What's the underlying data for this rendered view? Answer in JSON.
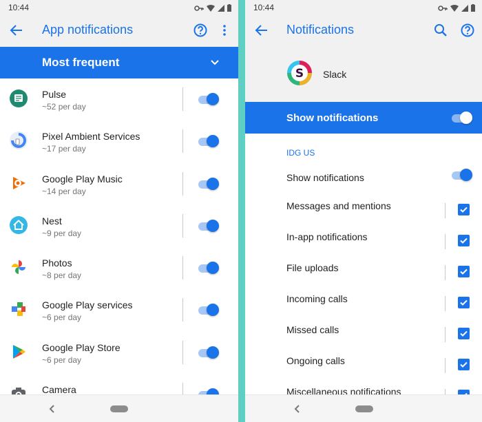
{
  "left": {
    "status": {
      "time": "10:44"
    },
    "appbar": {
      "title": "App notifications"
    },
    "section": {
      "title": "Most frequent"
    },
    "apps": [
      {
        "name": "Pulse",
        "sub": "~52 per day",
        "icon": "pulse-icon",
        "enabled": true
      },
      {
        "name": "Pixel Ambient Services",
        "sub": "~17 per day",
        "icon": "pixel-ambient-icon",
        "enabled": true
      },
      {
        "name": "Google Play Music",
        "sub": "~14 per day",
        "icon": "play-music-icon",
        "enabled": true
      },
      {
        "name": "Nest",
        "sub": "~9 per day",
        "icon": "nest-icon",
        "enabled": true
      },
      {
        "name": "Photos",
        "sub": "~8 per day",
        "icon": "photos-icon",
        "enabled": true
      },
      {
        "name": "Google Play services",
        "sub": "~6 per day",
        "icon": "play-services-icon",
        "enabled": true
      },
      {
        "name": "Google Play Store",
        "sub": "~6 per day",
        "icon": "play-store-icon",
        "enabled": true
      },
      {
        "name": "Camera",
        "sub": "",
        "icon": "camera-icon",
        "enabled": true
      }
    ]
  },
  "right": {
    "status": {
      "time": "10:44"
    },
    "appbar": {
      "title": "Notifications"
    },
    "app": {
      "name": "Slack",
      "icon": "slack-icon"
    },
    "master": {
      "label": "Show notifications",
      "enabled": true
    },
    "group": {
      "label": "IDG US"
    },
    "items": [
      {
        "label": "Show notifications",
        "control": "toggle",
        "checked": true
      },
      {
        "label": "Messages and mentions",
        "control": "checkbox",
        "checked": true
      },
      {
        "label": "In-app notifications",
        "control": "checkbox",
        "checked": true
      },
      {
        "label": "File uploads",
        "control": "checkbox",
        "checked": true
      },
      {
        "label": "Incoming calls",
        "control": "checkbox",
        "checked": true
      },
      {
        "label": "Missed calls",
        "control": "checkbox",
        "checked": true
      },
      {
        "label": "Ongoing calls",
        "control": "checkbox",
        "checked": true
      },
      {
        "label": "Miscellaneous notifications",
        "control": "checkbox",
        "checked": true
      }
    ]
  },
  "colors": {
    "accent": "#1a73e8",
    "divider": "#5ecfc2"
  }
}
